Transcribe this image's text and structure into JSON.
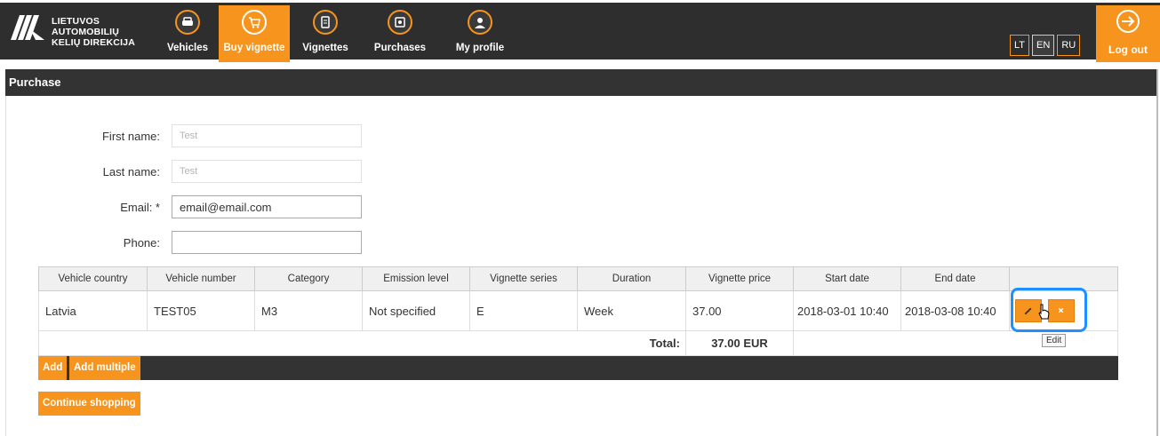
{
  "brand": {
    "line1": "LIETUVOS AUTOMOBILIŲ",
    "line2": "KELIŲ DIREKCIJA"
  },
  "nav": [
    {
      "label": "Vehicles",
      "icon": "car-icon"
    },
    {
      "label": "Buy vignette",
      "icon": "cart-icon",
      "active": true
    },
    {
      "label": "Vignettes",
      "icon": "vignette-icon"
    },
    {
      "label": "Purchases",
      "icon": "purchases-icon"
    },
    {
      "label": "My profile",
      "icon": "profile-icon"
    }
  ],
  "languages": [
    "LT",
    "EN",
    "RU"
  ],
  "selected_language": "EN",
  "logout_label": "Log out",
  "panel_title": "Purchase",
  "form": {
    "first_name": {
      "label": "First name:",
      "value": "Test"
    },
    "last_name": {
      "label": "Last name:",
      "value": "Test"
    },
    "email": {
      "label": "Email: *",
      "value": "email@email.com"
    },
    "phone": {
      "label": "Phone:",
      "value": ""
    }
  },
  "table": {
    "headers": [
      "Vehicle country",
      "Vehicle number",
      "Category",
      "Emission level",
      "Vignette series",
      "Duration",
      "Vignette price",
      "Start date",
      "End date",
      ""
    ],
    "rows": [
      [
        "Latvia",
        "TEST05",
        "M3",
        "Not specified",
        "E",
        "Week",
        "37.00",
        "2018-03-01 10:40",
        "2018-03-08 10:40"
      ]
    ],
    "total_label": "Total:",
    "total_value": "37.00 EUR"
  },
  "tooltip": "Edit",
  "buttons": {
    "add": "Add",
    "add_multiple": "Add multiple",
    "continue_shopping": "Continue shopping"
  },
  "colors": {
    "accent": "#f7941d",
    "dark": "#2e2e2e",
    "highlight": "#1e90ff"
  }
}
